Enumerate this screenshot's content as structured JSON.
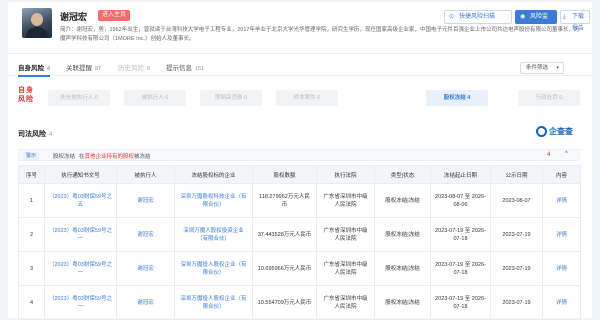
{
  "profile": {
    "name": "谢冠宏",
    "tag": "进入主页",
    "intro": "简介：谢冠宏，男，1962年出生，曾就读于台湾科技大学电子工程专业，2017年毕业于北京大学光华管理学院，研究生学历，现任国家高级企业家，中国电子元件百强企业上市公司共达电声股份有限公司董事长，万魔声学科技有限公司（1MORE Inc.）创始人及董事长。",
    "buttons": {
      "monitor": "快捷风险扫描",
      "risk": "风险监控",
      "download": "下载报告"
    }
  },
  "tabs": [
    {
      "label": "自身风险",
      "count": "4",
      "state": "active"
    },
    {
      "label": "关联提醒",
      "count": "87",
      "state": "normal"
    },
    {
      "label": "历史风险",
      "count": "0",
      "state": "disabled"
    },
    {
      "label": "提示信息",
      "count": "151",
      "state": "normal"
    }
  ],
  "filter": {
    "label": "条件筛选",
    "icon": "chevron-down-icon"
  },
  "logo_text": {
    "line1": "自身",
    "line2": "风险"
  },
  "pills": [
    {
      "label": "失信被执行人 0",
      "active": false
    },
    {
      "label": "被执行人 0",
      "active": false
    },
    {
      "label": "限制高消费 0",
      "active": false
    },
    {
      "label": "终本案件 0",
      "active": false
    },
    {
      "label": "股权冻结 4",
      "active": true
    },
    {
      "label": "行政处罚 0",
      "active": false
    }
  ],
  "section": {
    "title": "司法风险",
    "count": "4",
    "brand": "企查查"
  },
  "subbar": {
    "category": "警示",
    "label": "股权冻结",
    "desc_pre": "在",
    "desc_highlight": "其他企业持有的股权",
    "desc_post": "被冻结",
    "count": "4",
    "chevron": "^"
  },
  "table": {
    "headers": [
      "序号",
      "执行通知书文号",
      "被执行人",
      "冻结股权标的企业",
      "股权数额",
      "执行法院",
      "类型|状态",
      "冻结起止日期",
      "公示日期",
      "内容"
    ],
    "rows": [
      [
        "1",
        "（2023）粤03财保59号之五",
        "谢冠宏",
        "深圳万魔股权科技企业（有限合伙）",
        "118.279962万元人民币",
        "广东省深圳市中级人民法院",
        "股权冻结|冻结",
        "2023-08-07 至 2026-08-06",
        "2023-08-07",
        "详情"
      ],
      [
        "2",
        "（2023）粤03财保59号之一",
        "谢冠宏",
        "深圳万魔人股权投资企业（有限合伙）",
        "37.443528万元人民币",
        "广东省深圳市中级人民法院",
        "股权冻结|冻结",
        "2023-07-19 至 2026-07-18",
        "2023-07-19",
        "详情"
      ],
      [
        "3",
        "（2023）粤03财保59号之一",
        "谢冠宏",
        "深圳万魔投人股权企业（有限合伙）",
        "10.695966万元人民币",
        "广东省深圳市中级人民法院",
        "股权冻结|冻结",
        "2023-07-19 至 2026-07-18",
        "2023-07-19",
        "详情"
      ],
      [
        "4",
        "（2023）粤03财保59号之一",
        "谢冠宏",
        "深圳万魔投人股权企业（有限合伙）",
        "10.554709万元人民币",
        "广东省深圳市中级人民法院",
        "股权冻结|冻结",
        "2023-07-19 至 2026-07-18",
        "2023-07-19",
        "详情"
      ]
    ]
  },
  "colors": {
    "accent": "#3a7bd5",
    "danger": "#e8302f",
    "tag": "#f56c6c"
  }
}
